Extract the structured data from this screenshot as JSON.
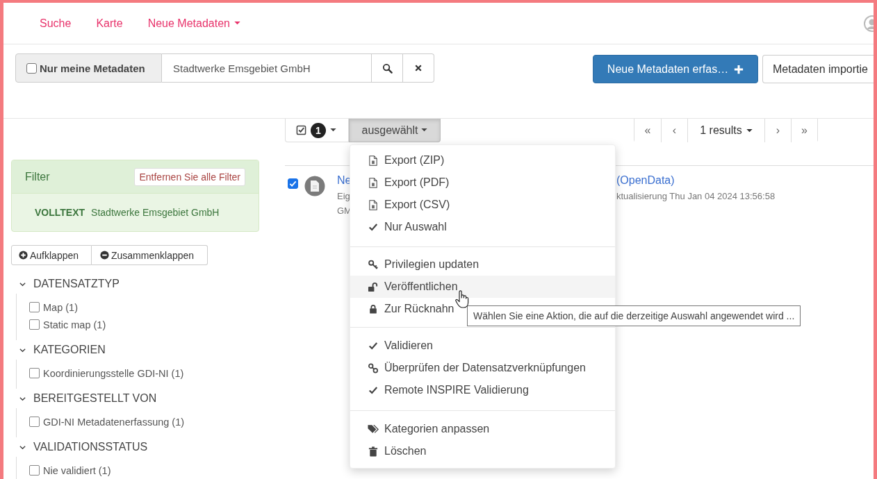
{
  "nav": {
    "links": [
      {
        "label": "Suche",
        "dropdown": false
      },
      {
        "label": "Karte",
        "dropdown": false
      },
      {
        "label": "Neue Metadaten",
        "dropdown": true
      }
    ]
  },
  "search": {
    "only_mine": {
      "label": "Nur meine Metadaten",
      "checked": false
    },
    "query": "Stadtwerke Emsgebiet GmbH"
  },
  "actions": {
    "create": "Neue Metadaten erfas…",
    "import": "Metadaten importie"
  },
  "filter": {
    "title": "Filter",
    "clear": "Entfernen Sie alle Filter",
    "terms": [
      {
        "key": "VOLLTEXT",
        "value": "Stadtwerke Emsgebiet GmbH"
      }
    ]
  },
  "tree_buttons": {
    "expand": "Aufklappen",
    "collapse": "Zusammenklappen"
  },
  "facets": [
    {
      "title": "DATENSATZTYP",
      "expanded": true,
      "items": [
        {
          "label": "Map (1)",
          "checked": false
        },
        {
          "label": "Static map (1)",
          "checked": false
        }
      ]
    },
    {
      "title": "KATEGORIEN",
      "expanded": true,
      "items": [
        {
          "label": "Koordinierungsstelle GDI-NI (1)",
          "checked": false
        }
      ]
    },
    {
      "title": "BEREITGESTELLT VON",
      "expanded": true,
      "items": [
        {
          "label": "GDI-NI Metadatenerfassung (1)",
          "checked": false
        }
      ]
    },
    {
      "title": "VALIDATIONSSTATUS",
      "expanded": true,
      "items": [
        {
          "label": "Nie validiert (1)",
          "checked": false
        }
      ]
    }
  ],
  "toolbar": {
    "selected_count": "1",
    "selection_button": "ausgewählt",
    "selection_open": true
  },
  "pagination": {
    "first": "«",
    "prev": "‹",
    "results": "1 results",
    "next": "›",
    "last": "»"
  },
  "results": [
    {
      "checked": true,
      "title_left": "Ne",
      "title_right": "(OpenData)",
      "detail_left": [
        "Eig",
        "GM"
      ],
      "detail_right": [
        "ktualisierung Thu Jan 04 2024 13:56:58"
      ]
    }
  ],
  "menu": {
    "groups": [
      [
        {
          "label": "Export (ZIP)",
          "highlighted": false
        },
        {
          "label": "Export (PDF)",
          "highlighted": false
        },
        {
          "label": "Export (CSV)",
          "highlighted": false
        },
        {
          "label": "Nur Auswahl",
          "highlighted": false
        }
      ],
      [
        {
          "label": "Privilegien updaten",
          "highlighted": false
        },
        {
          "label": "Veröffentlichen",
          "highlighted": true
        },
        {
          "label": "Zur Rücknahn",
          "highlighted": false
        }
      ],
      [
        {
          "label": "Validieren",
          "highlighted": false
        },
        {
          "label": "Überprüfen der Datensatzverknüpfungen",
          "highlighted": false
        },
        {
          "label": "Remote INSPIRE Validierung",
          "highlighted": false
        }
      ],
      [
        {
          "label": "Kategorien anpassen",
          "highlighted": false
        },
        {
          "label": "Löschen",
          "highlighted": false
        }
      ]
    ]
  },
  "tooltip": "Wählen Sie eine Aktion, die auf die derzeitige Auswahl angewendet wird ..."
}
